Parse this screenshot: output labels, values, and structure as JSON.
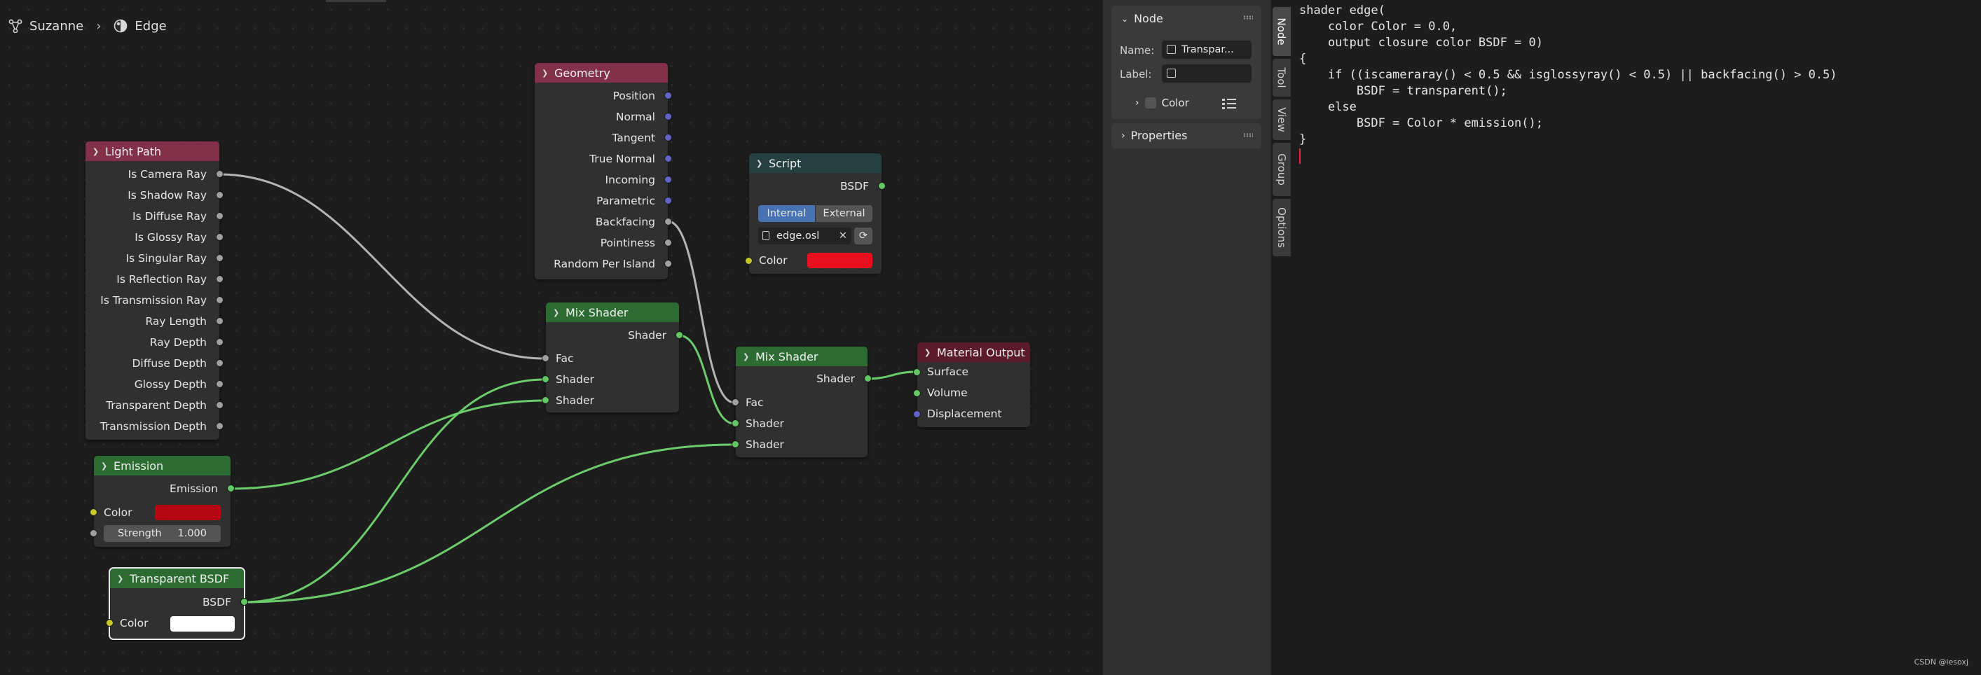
{
  "breadcrumb": {
    "object": "Suzanne",
    "material": "Edge"
  },
  "nodes": {
    "light_path": {
      "title": "Light Path",
      "outputs": [
        "Is Camera Ray",
        "Is Shadow Ray",
        "Is Diffuse Ray",
        "Is Glossy Ray",
        "Is Singular Ray",
        "Is Reflection Ray",
        "Is Transmission Ray",
        "Ray Length",
        "Ray Depth",
        "Diffuse Depth",
        "Glossy Depth",
        "Transparent Depth",
        "Transmission Depth"
      ]
    },
    "geometry": {
      "title": "Geometry",
      "outputs": [
        "Position",
        "Normal",
        "Tangent",
        "True Normal",
        "Incoming",
        "Parametric",
        "Backfacing",
        "Pointiness",
        "Random Per Island"
      ]
    },
    "script": {
      "title": "Script",
      "output": "BSDF",
      "mode_internal": "Internal",
      "mode_external": "External",
      "file": "edge.osl",
      "input_color": "Color",
      "color_value": "#e8101e"
    },
    "mix_shader_1": {
      "title": "Mix Shader",
      "output": "Shader",
      "inputs": [
        "Fac",
        "Shader",
        "Shader"
      ]
    },
    "mix_shader_2": {
      "title": "Mix Shader",
      "output": "Shader",
      "inputs": [
        "Fac",
        "Shader",
        "Shader"
      ]
    },
    "material_output": {
      "title": "Material Output",
      "inputs": [
        "Surface",
        "Volume",
        "Displacement"
      ]
    },
    "emission": {
      "title": "Emission",
      "output": "Emission",
      "color_label": "Color",
      "color_value": "#b50713",
      "strength_label": "Strength",
      "strength_value": "1.000"
    },
    "transparent_bsdf": {
      "title": "Transparent BSDF",
      "output": "BSDF",
      "color_label": "Color",
      "color_value": "#ffffff"
    }
  },
  "sidebar": {
    "node_panel": {
      "title": "Node",
      "name_label": "Name:",
      "name_value": "Transpar...",
      "label_label": "Label:",
      "color_label": "Color"
    },
    "properties_panel": {
      "title": "Properties"
    },
    "tabs": [
      "Node",
      "Tool",
      "View",
      "Group",
      "Options"
    ]
  },
  "text_editor": {
    "code": "shader edge(\n    color Color = 0.0,\n    output closure color BSDF = 0)\n{\n    if ((iscameraray() < 0.5 && isglossyray() < 0.5) || backfacing() > 0.5)\n        BSDF = transparent();\n    else\n        BSDF = Color * emission();\n}"
  },
  "watermark": "CSDN @iesoxj",
  "colors": {
    "input": "#83314a",
    "shader": "#2c6b32",
    "script": "#244040",
    "output": "#5c1b2a",
    "wire_grey": "#b4b4b4",
    "wire_green": "#6ccc6c"
  }
}
